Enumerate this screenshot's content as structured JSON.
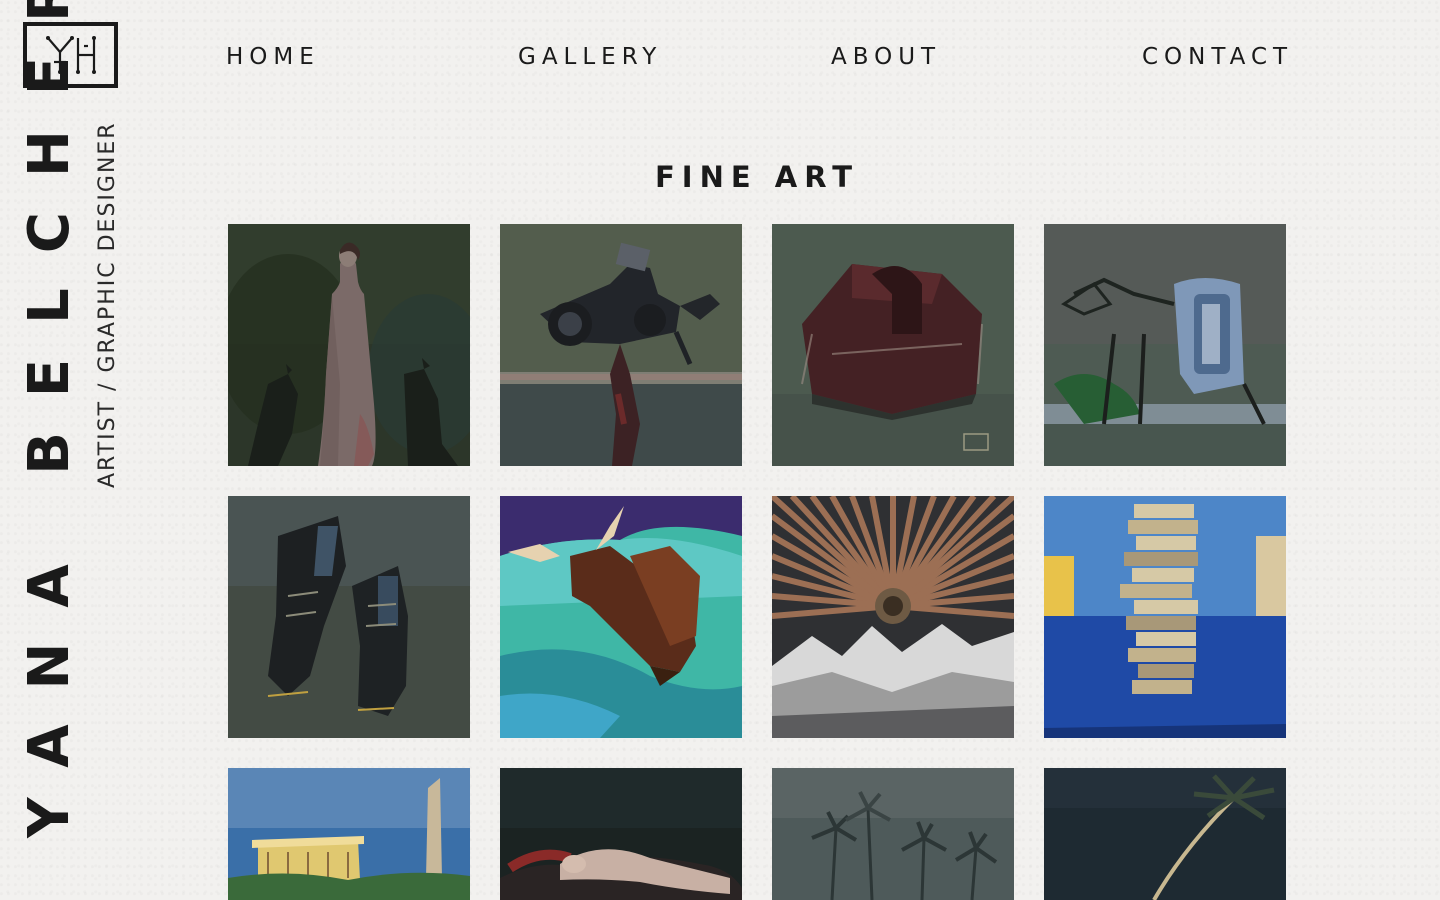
{
  "site": {
    "name": "YANA BELCHER",
    "tagline": "ARTIST / GRAPHIC DESIGNER",
    "logo_monogram": "YH"
  },
  "nav": {
    "home": "HOME",
    "gallery": "GALLERY",
    "about": "ABOUT",
    "contact": "CONTACT"
  },
  "page": {
    "title": "FINE ART"
  },
  "colors": {
    "background": "#f2f1ef",
    "text": "#1a1a1a"
  },
  "gallery": {
    "items": [
      {
        "subject": "woman-in-dress-with-dogs",
        "palette": [
          "#2f3a2c",
          "#1f2620",
          "#8a7a78"
        ]
      },
      {
        "subject": "camera-strap",
        "palette": [
          "#4b5448",
          "#23262a",
          "#6b2a2a"
        ]
      },
      {
        "subject": "leather-bag",
        "palette": [
          "#4c5a4f",
          "#4a2427",
          "#7a6a62"
        ]
      },
      {
        "subject": "hand-mixer",
        "palette": [
          "#4b5a52",
          "#4f6f9a",
          "#2c6a3a"
        ]
      },
      {
        "subject": "boots",
        "palette": [
          "#434b44",
          "#1e2224",
          "#3f5366"
        ]
      },
      {
        "subject": "bull-and-woman",
        "palette": [
          "#3fb7a6",
          "#5a2c1a",
          "#3a2a6b"
        ]
      },
      {
        "subject": "radial-sun-mountains",
        "palette": [
          "#3a3a3c",
          "#b07a5a",
          "#d8d8d8"
        ]
      },
      {
        "subject": "jenga-tower",
        "palette": [
          "#2a5bb0",
          "#d6c9a6",
          "#e8c24a"
        ]
      },
      {
        "subject": "memorial-landscape",
        "palette": [
          "#3a6fa8",
          "#e0c870",
          "#2a5a2a"
        ]
      },
      {
        "subject": "reclining-figure",
        "palette": [
          "#1b2322",
          "#8a2a28",
          "#c8b0a4"
        ]
      },
      {
        "subject": "palm-trees-fog",
        "palette": [
          "#4e5a5a",
          "#2c3636",
          "#6a7070"
        ]
      },
      {
        "subject": "single-palm-night",
        "palette": [
          "#1e2a32",
          "#3a4a3a",
          "#c8b890"
        ]
      }
    ]
  }
}
